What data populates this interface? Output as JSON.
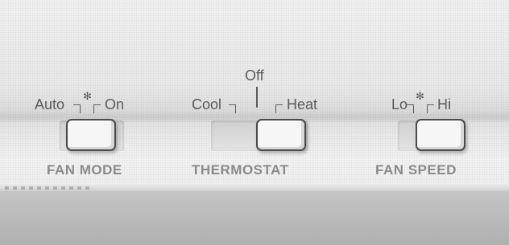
{
  "fan_mode": {
    "caption": "FAN MODE",
    "option_auto": "Auto",
    "option_on": "On",
    "icon": "fan-icon",
    "selected": "On"
  },
  "thermostat": {
    "caption": "THERMOSTAT",
    "option_cool": "Cool",
    "option_off": "Off",
    "option_heat": "Heat",
    "selected": "Heat"
  },
  "fan_speed": {
    "caption": "FAN SPEED",
    "option_lo": "Lo",
    "option_hi": "Hi",
    "icon": "fan-icon",
    "selected": "Hi"
  },
  "colors": {
    "label_text": "#5b5b5b",
    "caption_text": "#8a8a8a",
    "switch_outline": "#4a4a4a"
  }
}
